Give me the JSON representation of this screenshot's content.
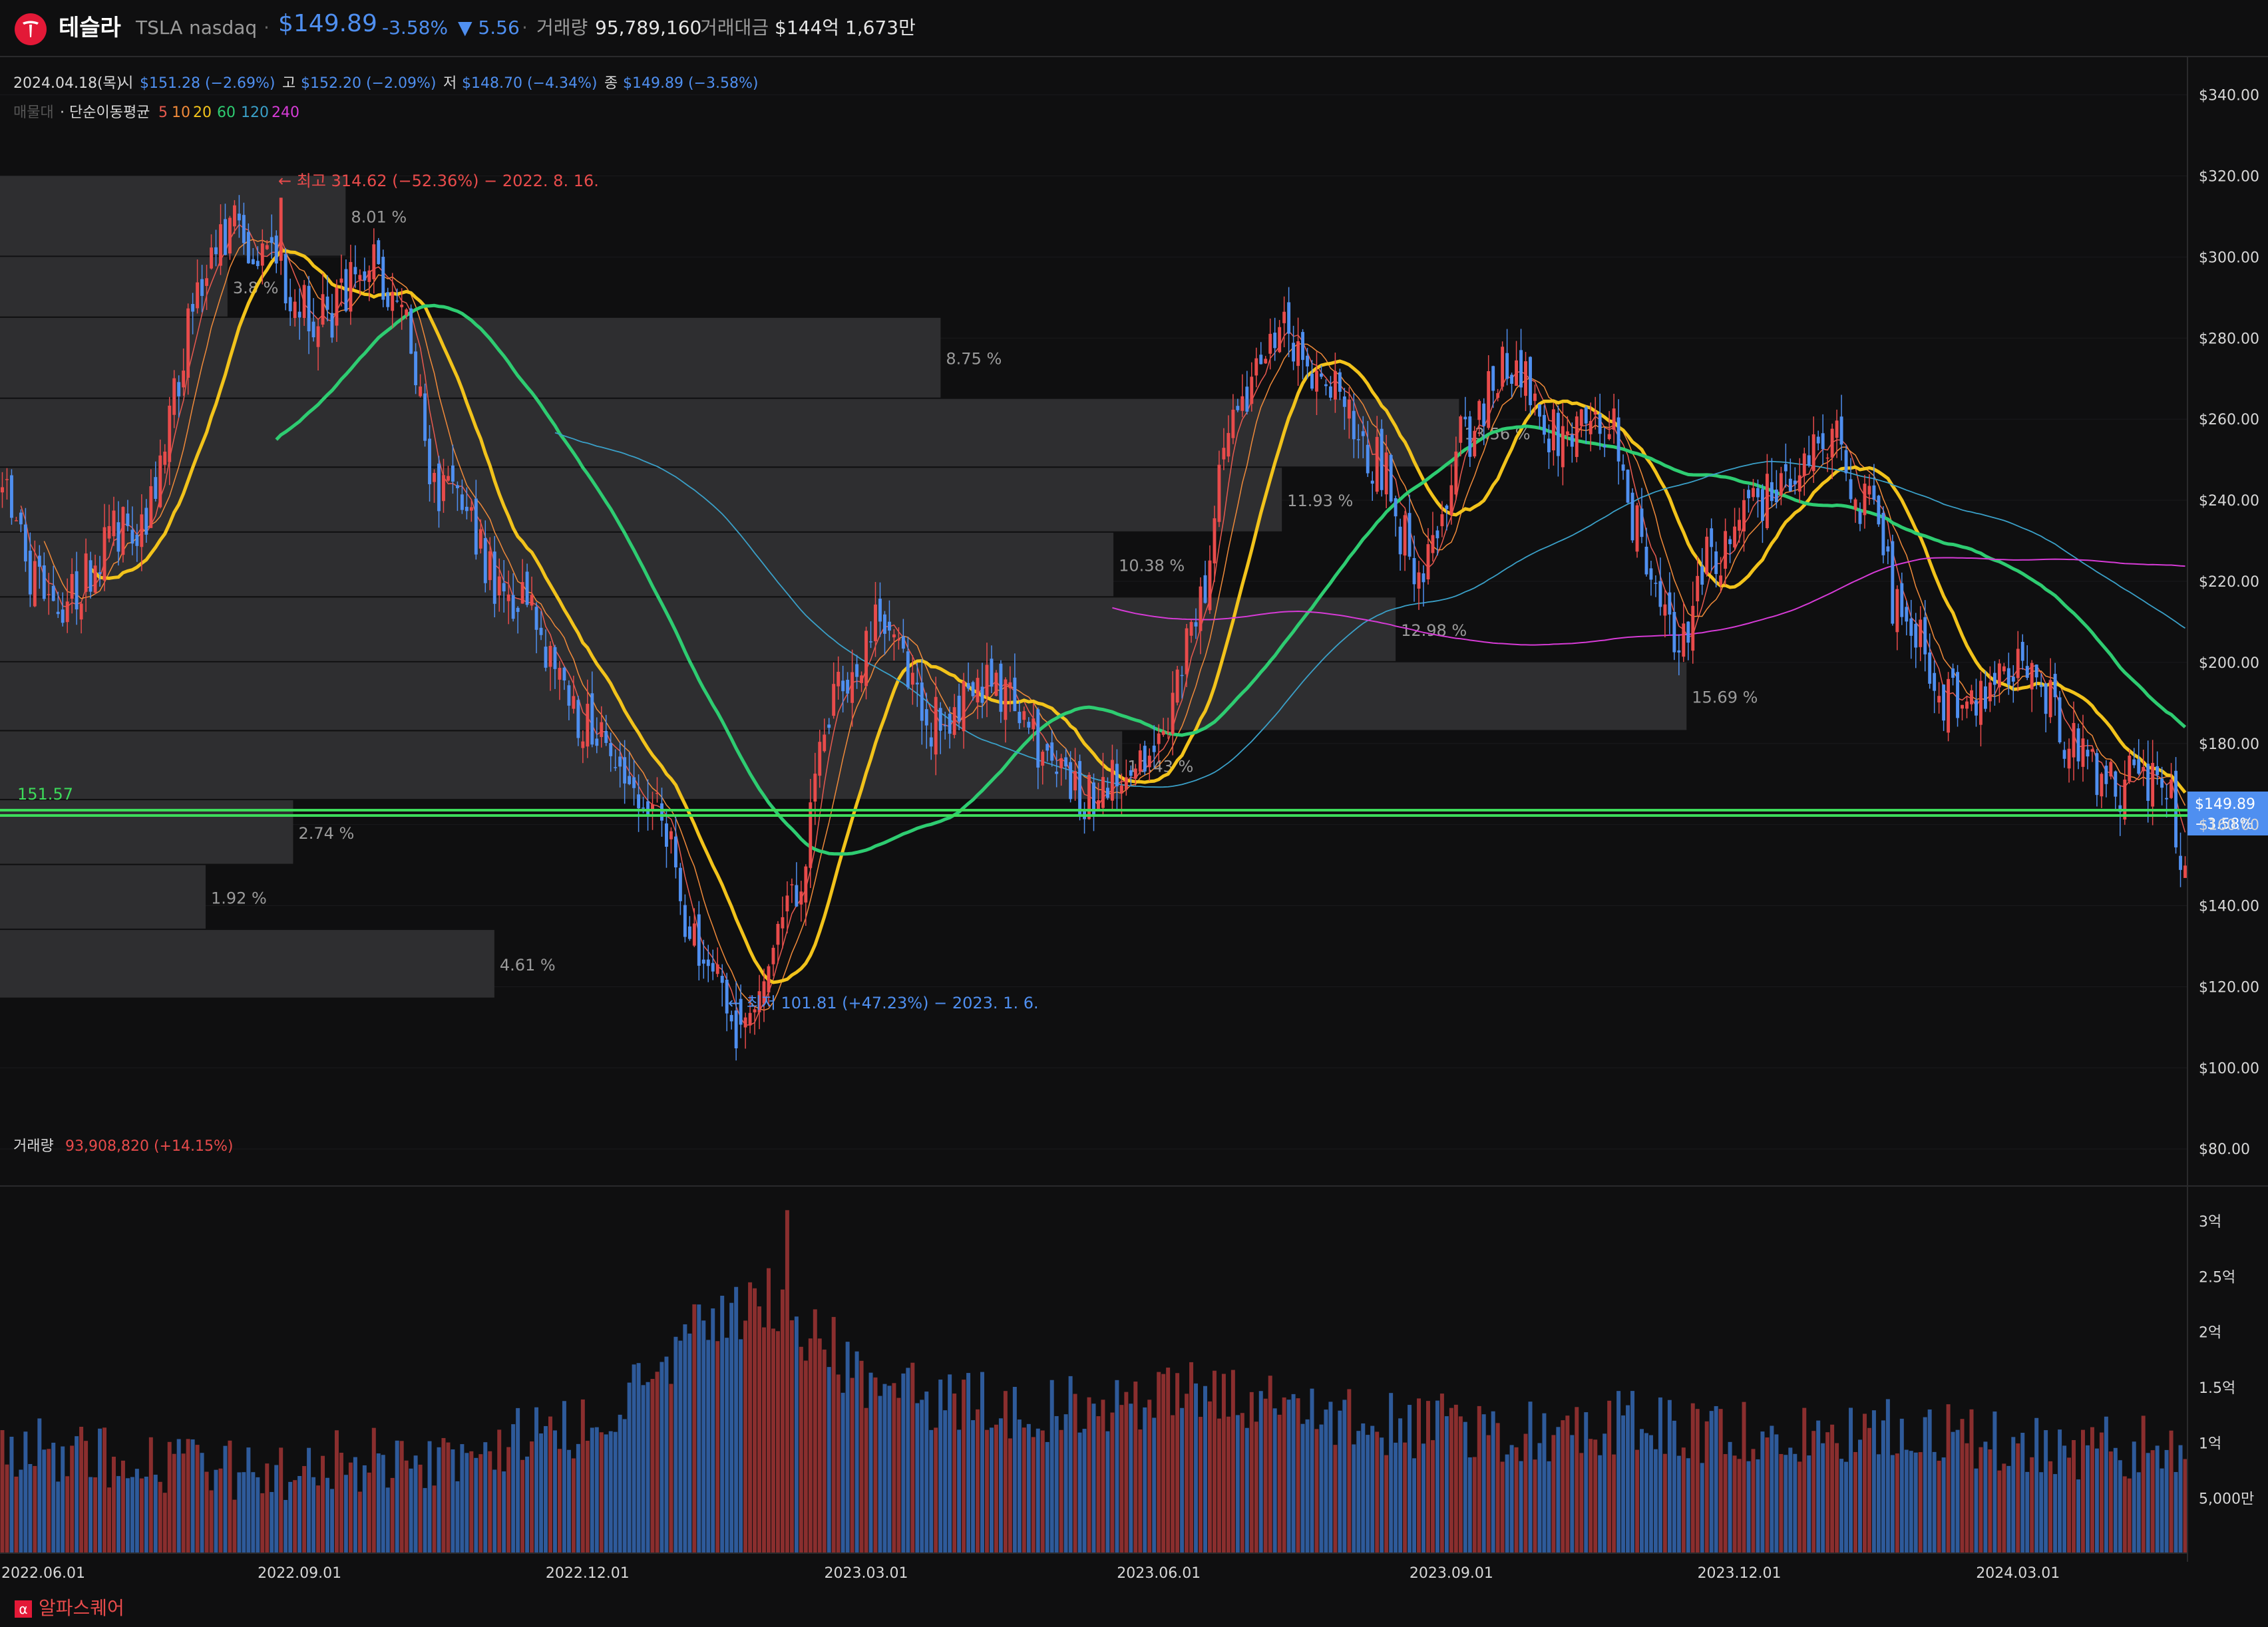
{
  "header": {
    "name": "테슬라",
    "ticker": "TSLA",
    "exchange": "nasdaq",
    "price": "$149.89",
    "change_pct": "-3.58%",
    "change_abs": "▼ 5.56",
    "volume_label": "거래량",
    "volume_value": "95,789,160",
    "turnover_label": "거래대금",
    "turnover_value": "$144억 1,673만"
  },
  "ohlc": {
    "date": "2024.04.18(목)",
    "open_label": "시",
    "open_value": "$151.28 (−2.69%)",
    "high_label": "고",
    "high_value": "$152.20 (−2.09%)",
    "low_label": "저",
    "low_value": "$148.70 (−4.34%)",
    "close_label": "종",
    "close_value": "$149.89 (−3.58%)"
  },
  "indicator": {
    "vp_label": "매물대",
    "ma_label": "· 단순이동평균",
    "periods": [
      "5",
      "10",
      "20",
      "60",
      "120",
      "240"
    ],
    "period_colors": [
      "#e85a4f",
      "#f08a3a",
      "#f2c31b",
      "#2ecc71",
      "#3aa0c8",
      "#d63bd6"
    ]
  },
  "annotations": {
    "high": "← 최고 314.62 (−52.36%) − 2022. 8. 16.",
    "low": "← 최저 101.81 (+47.23%) − 2023. 1. 6.",
    "support_value": "151.57",
    "current_price": "$149.89",
    "current_change": "−3.58%"
  },
  "colors": {
    "up": "#e84b4b",
    "down": "#4f8ff0",
    "ma5": "#e85a4f",
    "ma10": "#f08a3a",
    "ma20": "#f2c31b",
    "ma60": "#2ecc71",
    "ma120": "#3aa0c8",
    "ma240": "#d63bd6",
    "support": "#3ddc5a",
    "vol_up": "#8a2e2e",
    "vol_down": "#2e5a9a"
  },
  "volume_panel": {
    "label": "거래량",
    "value": "93,908,820 (+14.15%)"
  },
  "footer": {
    "brand": "알파스퀘어",
    "brand_mark": "α"
  },
  "chart_data": {
    "type": "candlestick",
    "price_axis": [
      "$340.00",
      "$320.00",
      "$300.00",
      "$280.00",
      "$260.00",
      "$240.00",
      "$220.00",
      "$200.00",
      "$180.00",
      "$160.00",
      "$140.00",
      "$120.00",
      "$100.00",
      "$80.00"
    ],
    "price_values": [
      340,
      320,
      300,
      280,
      260,
      240,
      220,
      200,
      180,
      160,
      140,
      120,
      100,
      80
    ],
    "ylim": [
      72,
      346
    ],
    "volume_axis": [
      "3억",
      "2.5억",
      "2억",
      "1.5억",
      "1억",
      "5,000만"
    ],
    "volume_values": [
      300,
      250,
      200,
      150,
      100,
      50
    ],
    "volume_ylim": [
      0,
      330
    ],
    "x_labels": [
      "2022.06.01",
      "2022.09.01",
      "2022.12.01",
      "2023.03.01",
      "2023.06.01",
      "2023.09.01",
      "2023.12.01",
      "2024.03.01"
    ],
    "x_label_index": [
      0,
      63,
      125,
      185,
      248,
      311,
      373,
      433
    ],
    "bar_count": 471,
    "close_anchors": [
      [
        0,
        240
      ],
      [
        10,
        215
      ],
      [
        30,
        235
      ],
      [
        45,
        300
      ],
      [
        50,
        310
      ],
      [
        55,
        300
      ],
      [
        70,
        285
      ],
      [
        80,
        300
      ],
      [
        85,
        285
      ],
      [
        95,
        240
      ],
      [
        110,
        215
      ],
      [
        125,
        185
      ],
      [
        140,
        165
      ],
      [
        150,
        130
      ],
      [
        160,
        110
      ],
      [
        163,
        120
      ],
      [
        170,
        140
      ],
      [
        180,
        195
      ],
      [
        190,
        210
      ],
      [
        200,
        185
      ],
      [
        210,
        195
      ],
      [
        225,
        180
      ],
      [
        235,
        165
      ],
      [
        240,
        170
      ],
      [
        250,
        185
      ],
      [
        258,
        215
      ],
      [
        265,
        260
      ],
      [
        275,
        280
      ],
      [
        285,
        270
      ],
      [
        295,
        250
      ],
      [
        305,
        225
      ],
      [
        315,
        255
      ],
      [
        325,
        275
      ],
      [
        335,
        255
      ],
      [
        345,
        260
      ],
      [
        355,
        225
      ],
      [
        360,
        205
      ],
      [
        368,
        225
      ],
      [
        375,
        240
      ],
      [
        385,
        245
      ],
      [
        395,
        258
      ],
      [
        400,
        240
      ],
      [
        410,
        210
      ],
      [
        420,
        190
      ],
      [
        430,
        195
      ],
      [
        437,
        200
      ],
      [
        445,
        180
      ],
      [
        455,
        170
      ],
      [
        465,
        172
      ],
      [
        470,
        150
      ]
    ],
    "volume_anchors": [
      [
        0,
        100
      ],
      [
        20,
        90
      ],
      [
        40,
        80
      ],
      [
        60,
        75
      ],
      [
        80,
        85
      ],
      [
        100,
        90
      ],
      [
        120,
        110
      ],
      [
        140,
        150
      ],
      [
        150,
        200
      ],
      [
        165,
        230
      ],
      [
        175,
        200
      ],
      [
        185,
        160
      ],
      [
        200,
        140
      ],
      [
        220,
        130
      ],
      [
        240,
        135
      ],
      [
        255,
        155
      ],
      [
        270,
        140
      ],
      [
        290,
        120
      ],
      [
        310,
        115
      ],
      [
        330,
        110
      ],
      [
        350,
        120
      ],
      [
        370,
        110
      ],
      [
        390,
        105
      ],
      [
        410,
        115
      ],
      [
        430,
        100
      ],
      [
        450,
        95
      ],
      [
        470,
        95
      ]
    ],
    "highlight_bar": [
      [
        169,
        310
      ]
    ],
    "volume_profile": [
      {
        "band": [
          300,
          320
        ],
        "pct": "8.01 %",
        "frac": 0.158
      },
      {
        "band": [
          285,
          300
        ],
        "pct": "3.8 %",
        "frac": 0.104
      },
      {
        "band": [
          265,
          285
        ],
        "pct": "8.75 %",
        "frac": 0.43
      },
      {
        "band": [
          248,
          265
        ],
        "pct": "13.56 %",
        "frac": 0.667
      },
      {
        "band": [
          232,
          248
        ],
        "pct": "11.93 %",
        "frac": 0.586
      },
      {
        "band": [
          216,
          232
        ],
        "pct": "10.38 %",
        "frac": 0.509
      },
      {
        "band": [
          200,
          216
        ],
        "pct": "12.98 %",
        "frac": 0.638
      },
      {
        "band": [
          183,
          200
        ],
        "pct": "15.69 %",
        "frac": 0.771
      },
      {
        "band": [
          166,
          183
        ],
        "pct": "10.43 %",
        "frac": 0.513
      },
      {
        "band": [
          150,
          166
        ],
        "pct": "2.74 %",
        "frac": 0.134
      },
      {
        "band": [
          134,
          150
        ],
        "pct": "1.92 %",
        "frac": 0.094
      },
      {
        "band": [
          117,
          134
        ],
        "pct": "4.61 %",
        "frac": 0.226
      }
    ],
    "support_level": 151.57,
    "high_point": {
      "index": 60,
      "value": 314.62
    },
    "low_point": {
      "index": 158,
      "value": 101.81
    },
    "last_close": 149.89
  }
}
